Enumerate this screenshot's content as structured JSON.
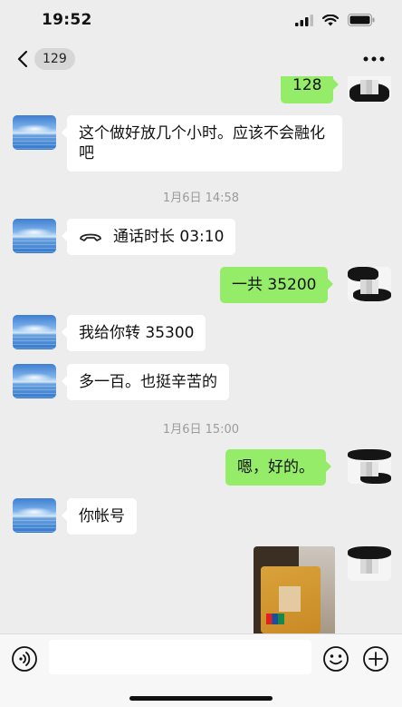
{
  "status_bar": {
    "time": "19:52"
  },
  "nav": {
    "unread_count": "129"
  },
  "messages": {
    "m0": {
      "text": "128"
    },
    "m1": {
      "text": "这个做好放几个小时。应该不会融化吧"
    },
    "ts1": {
      "text": "1月6日 14:58"
    },
    "m2": {
      "text": "通话时长 03:10"
    },
    "m3": {
      "text": "一共 35200"
    },
    "m4": {
      "text": "我给你转 35300"
    },
    "m5": {
      "text": "多一百。也挺辛苦的"
    },
    "ts2": {
      "text": "1月6日 15:00"
    },
    "m6": {
      "text": "嗯，好的。"
    },
    "m7": {
      "text": "你帐号"
    }
  },
  "input": {
    "value": "",
    "placeholder": ""
  },
  "colors": {
    "background": "#ededed",
    "bubble_self": "#95ec69",
    "bubble_other": "#ffffff",
    "timestamp": "#9b9b9b"
  },
  "icons": [
    "back-icon",
    "more-icon",
    "call-icon",
    "voice-icon",
    "emoji-icon",
    "plus-icon",
    "signal-icon",
    "wifi-icon",
    "battery-icon"
  ]
}
